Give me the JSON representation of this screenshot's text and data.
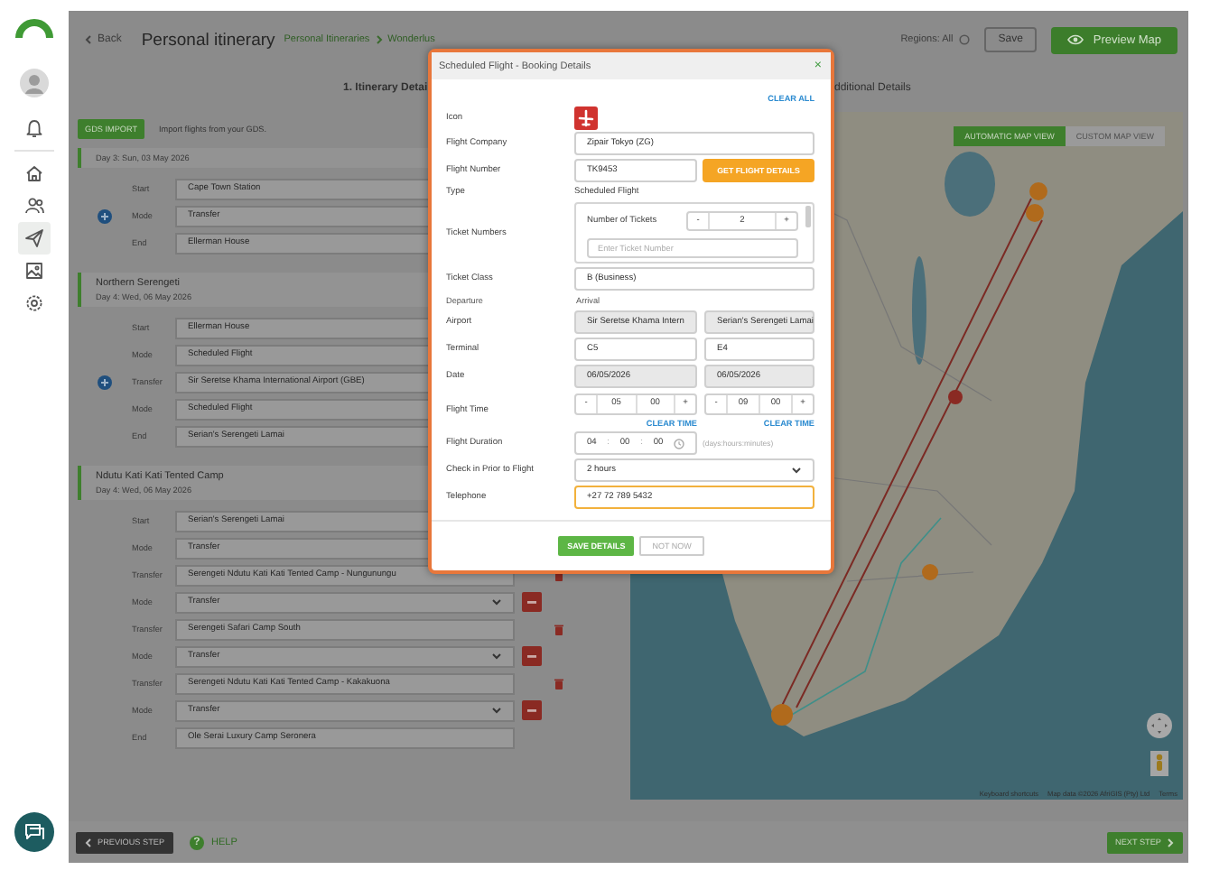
{
  "sidebar": {
    "items": [
      {
        "kind": "bell",
        "selected": false
      },
      {
        "kind": "home",
        "selected": false
      },
      {
        "kind": "people",
        "selected": false
      },
      {
        "kind": "send",
        "selected": true
      },
      {
        "kind": "image",
        "selected": false
      },
      {
        "kind": "settings",
        "selected": false
      }
    ]
  },
  "header": {
    "back": "Back",
    "title": "Personal itinerary",
    "breadcrumb": [
      "Personal Itineraries",
      "Wonderlus"
    ],
    "regions": "Regions: All",
    "save": "Save",
    "preview": "Preview Map"
  },
  "tabs": [
    {
      "label": "1. Itinerary Detai",
      "selected": true
    },
    {
      "label": "dditional Details",
      "selected": false
    }
  ],
  "gds": {
    "button": "GDS IMPORT",
    "text": "Import flights from your GDS."
  },
  "days": [
    {
      "date": "Day 3: Sun, 03 May 2026",
      "add_stop": true,
      "rows": [
        {
          "label": "Start",
          "value": "Cape Town Station",
          "kind": "text"
        },
        {
          "label": "Mode",
          "value": "Transfer",
          "kind": "text"
        },
        {
          "label": "End",
          "value": "Ellerman House",
          "kind": "text"
        }
      ]
    },
    {
      "title": "Northern Serengeti",
      "date": "Day 4: Wed, 06 May 2026",
      "add_stop": true,
      "rows": [
        {
          "label": "Start",
          "value": "Ellerman House",
          "kind": "text"
        },
        {
          "label": "Mode",
          "value": "Scheduled Flight",
          "kind": "text"
        },
        {
          "label": "Transfer",
          "value": "Sir Seretse Khama International Airport (GBE)",
          "kind": "text"
        },
        {
          "label": "Mode",
          "value": "Scheduled Flight",
          "kind": "text"
        },
        {
          "label": "End",
          "value": "Serian's Serengeti Lamai",
          "kind": "text"
        }
      ]
    },
    {
      "title": "Ndutu Kati Kati Tented Camp",
      "date": "Day 4: Wed, 06 May 2026",
      "rows": [
        {
          "label": "Start",
          "value": "Serian's Serengeti Lamai",
          "kind": "text"
        },
        {
          "label": "Mode",
          "value": "Transfer",
          "kind": "select"
        },
        {
          "label": "Transfer",
          "value": "Serengeti Ndutu Kati Kati Tented Camp - Nungunungu",
          "kind": "stop"
        },
        {
          "label": "Mode",
          "value": "Transfer",
          "kind": "select"
        },
        {
          "label": "Transfer",
          "value": "Serengeti Safari Camp South",
          "kind": "stop"
        },
        {
          "label": "Mode",
          "value": "Transfer",
          "kind": "select"
        },
        {
          "label": "Transfer",
          "value": "Serengeti Ndutu Kati Kati Tented Camp - Kakakuona",
          "kind": "stop"
        },
        {
          "label": "Mode",
          "value": "Transfer",
          "kind": "select"
        },
        {
          "label": "End",
          "value": "Ole Serai Luxury Camp Seronera",
          "kind": "text"
        }
      ]
    }
  ],
  "map": {
    "views": [
      {
        "label": "AUTOMATIC MAP VIEW",
        "selected": true
      },
      {
        "label": "CUSTOM MAP VIEW",
        "selected": false
      }
    ],
    "attribution": [
      "Keyboard shortcuts",
      "Map data ©2026 AfriGIS (Pty) Ltd",
      "Terms"
    ]
  },
  "footer": {
    "previous": "PREVIOUS STEP",
    "help_icon": "?",
    "help": "HELP",
    "next": "NEXT STEP"
  },
  "dialog": {
    "title": "Scheduled Flight - Booking Details",
    "close": "×",
    "clear_all": "CLEAR ALL",
    "fields": [
      {
        "kind": "icon",
        "label": "Icon"
      },
      {
        "kind": "input",
        "label": "Flight Company",
        "value": "Zipair Tokyo (ZG)"
      },
      {
        "kind": "input",
        "label": "Flight Number",
        "value": "TK9453",
        "button": "GET FLIGHT DETAILS"
      },
      {
        "kind": "text",
        "label": "Type",
        "value": "Scheduled Flight"
      },
      {
        "kind": "tickets",
        "label": "Ticket Numbers",
        "count_label": "Number of Tickets",
        "minus": "-",
        "count": "2",
        "plus": "+",
        "placeholder": "Enter Ticket Number"
      },
      {
        "kind": "input",
        "label": "Ticket Class",
        "value": "B (Business)"
      },
      {
        "kind": "heads",
        "headings": [
          "Departure",
          "Arrival"
        ]
      },
      {
        "kind": "pair",
        "label": "Airport",
        "values": [
          {
            "value": "Sir Seretse Khama Intern",
            "disabled": true
          },
          {
            "value": "Serian's Serengeti Lamai",
            "disabled": true
          }
        ]
      },
      {
        "kind": "pair",
        "label": "Terminal",
        "values": [
          {
            "value": "C5",
            "disabled": false
          },
          {
            "value": "E4",
            "disabled": false
          }
        ]
      },
      {
        "kind": "pair",
        "label": "Date",
        "values": [
          {
            "value": "06/05/2026",
            "disabled": true
          },
          {
            "value": "06/05/2026",
            "disabled": true
          }
        ]
      },
      {
        "kind": "time",
        "label": "Flight Time",
        "times": [
          {
            "minus": "-",
            "hour": "05",
            "minute": "00",
            "plus": "+",
            "clear": "CLEAR TIME"
          },
          {
            "minus": "-",
            "hour": "09",
            "minute": "00",
            "plus": "+",
            "clear": "CLEAR TIME"
          }
        ]
      },
      {
        "kind": "duration",
        "label": "Flight Duration",
        "parts": [
          "04",
          "00",
          "00"
        ],
        "separators": [
          ":",
          ":"
        ],
        "hint": "(days:hours:minutes)"
      },
      {
        "kind": "select",
        "label": "Check in Prior to Flight",
        "value": "2 hours"
      },
      {
        "kind": "input",
        "label": "Telephone",
        "value": "+27 72 789 5432",
        "focused": true
      }
    ],
    "save": "SAVE DETAILS",
    "cancel": "NOT NOW"
  }
}
